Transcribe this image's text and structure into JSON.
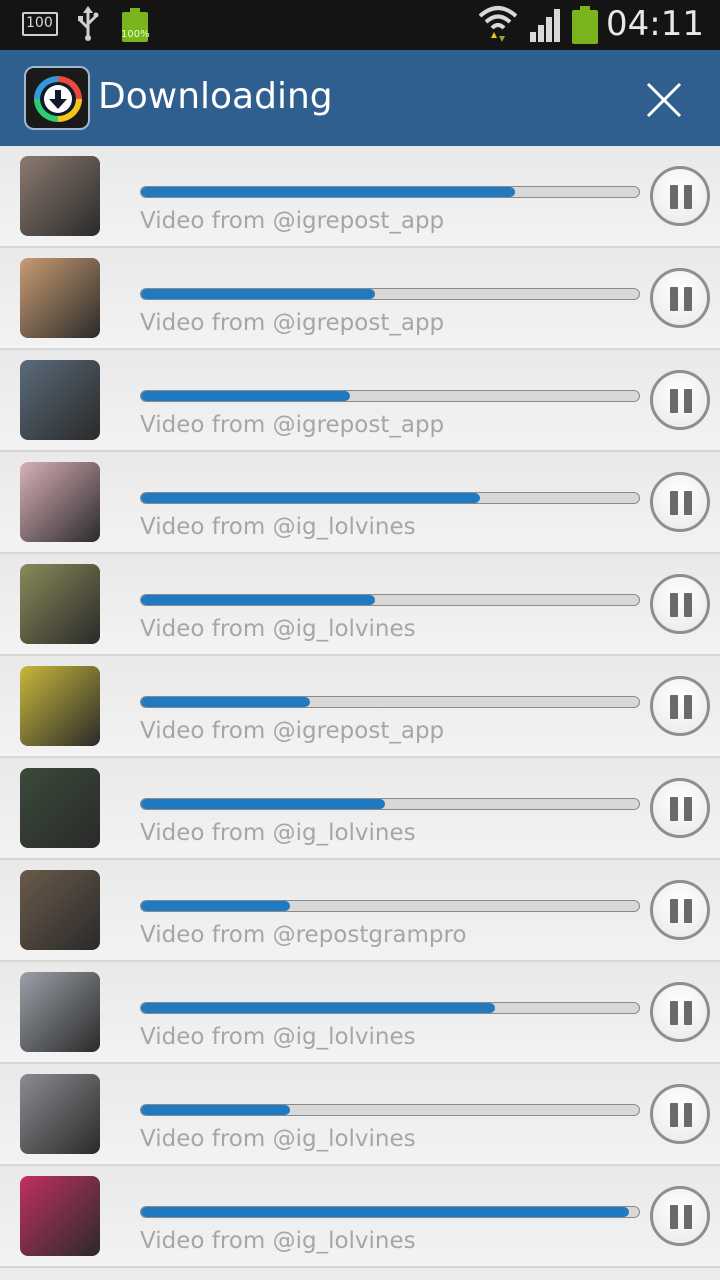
{
  "status_bar": {
    "notification_count": "100",
    "battery_percent": "100%",
    "time": "04:11",
    "icons": [
      "notification-100-icon",
      "usb-icon",
      "battery-full-icon",
      "wifi-icon",
      "signal-icon",
      "battery-icon"
    ]
  },
  "header": {
    "title": "Downloading",
    "app_icon": "download-app-icon",
    "close_icon": "close-icon"
  },
  "colors": {
    "header_bg": "#2f5f8e",
    "progress_fill": "#1f7ac2",
    "label_text": "#a6a6a6"
  },
  "downloads": [
    {
      "label": "Video from @igrepost_app",
      "progress": 0.75,
      "thumb": "#8c7a70"
    },
    {
      "label": "Video from @igrepost_app",
      "progress": 0.47,
      "thumb": "#c89c72"
    },
    {
      "label": "Video from @igrepost_app",
      "progress": 0.42,
      "thumb": "#5a6a7a"
    },
    {
      "label": "Video from @ig_lolvines",
      "progress": 0.68,
      "thumb": "#d8b0b8"
    },
    {
      "label": "Video from @ig_lolvines",
      "progress": 0.47,
      "thumb": "#8a8a5a"
    },
    {
      "label": "Video from @igrepost_app",
      "progress": 0.34,
      "thumb": "#c8b83a"
    },
    {
      "label": "Video from @ig_lolvines",
      "progress": 0.49,
      "thumb": "#3a4a3a"
    },
    {
      "label": "Video from @repostgrampro",
      "progress": 0.3,
      "thumb": "#6a5a4a"
    },
    {
      "label": "Video from @ig_lolvines",
      "progress": 0.71,
      "thumb": "#9aa0a8"
    },
    {
      "label": "Video from @ig_lolvines",
      "progress": 0.3,
      "thumb": "#8a8c90"
    },
    {
      "label": "Video from @ig_lolvines",
      "progress": 0.98,
      "thumb": "#c03060"
    }
  ]
}
